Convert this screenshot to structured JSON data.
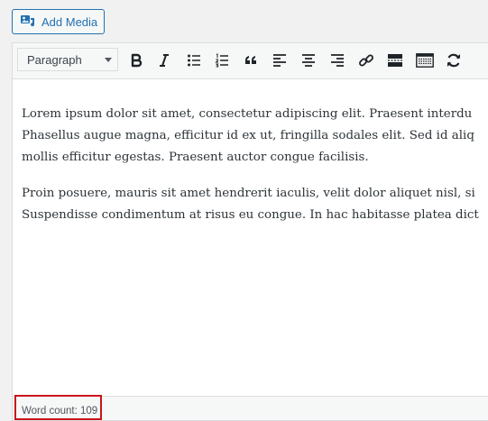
{
  "add_media": {
    "label": "Add Media",
    "icon": "media-icon"
  },
  "toolbar": {
    "format": {
      "selected": "Paragraph"
    },
    "buttons": [
      {
        "name": "bold",
        "icon": "bold-icon"
      },
      {
        "name": "italic",
        "icon": "italic-icon"
      },
      {
        "name": "bulleted-list",
        "icon": "bulleted-list-icon"
      },
      {
        "name": "numbered-list",
        "icon": "numbered-list-icon"
      },
      {
        "name": "blockquote",
        "icon": "blockquote-icon"
      },
      {
        "name": "align-left",
        "icon": "align-left-icon"
      },
      {
        "name": "align-center",
        "icon": "align-center-icon"
      },
      {
        "name": "align-right",
        "icon": "align-right-icon"
      },
      {
        "name": "insert-link",
        "icon": "link-icon"
      },
      {
        "name": "read-more",
        "icon": "read-more-icon"
      },
      {
        "name": "toolbar-toggle",
        "icon": "keyboard-icon"
      },
      {
        "name": "convert",
        "icon": "refresh-icon"
      }
    ]
  },
  "content": {
    "paragraphs": [
      {
        "lines": [
          "Lorem ipsum dolor sit amet, consectetur adipiscing elit. Praesent interdu",
          "Phasellus augue magna, efficitur id ex ut, fringilla sodales elit. Sed id aliq",
          "mollis efficitur egestas. Praesent auctor congue facilisis."
        ]
      },
      {
        "lines": [
          "Proin posuere, mauris sit amet hendrerit iaculis, velit dolor aliquet nisl, si",
          "Suspendisse condimentum at risus eu congue. In hac habitasse platea dict"
        ]
      }
    ]
  },
  "status": {
    "word_count": "Word count: 109"
  },
  "colors": {
    "accent": "#2271b1",
    "highlight": "#c9141a"
  }
}
